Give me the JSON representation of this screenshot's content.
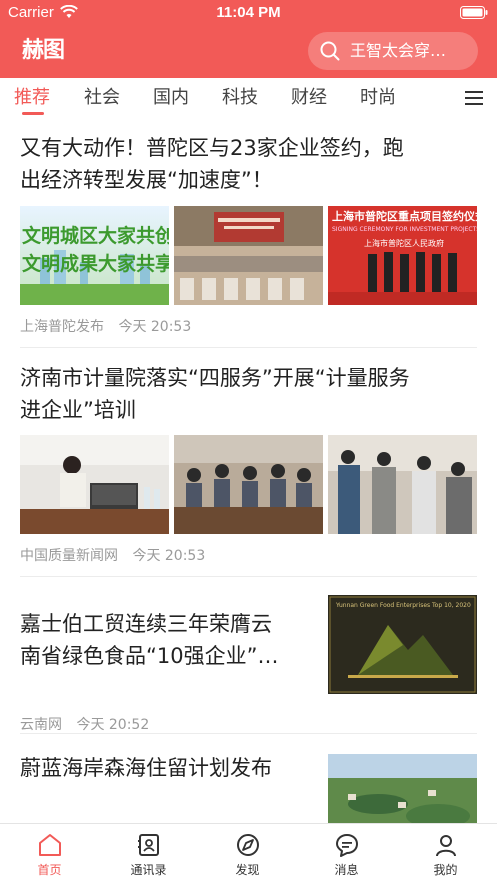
{
  "status_bar": {
    "carrier": "Carrier",
    "time": "11:04 PM"
  },
  "header": {
    "logo": "赫图",
    "search_placeholder": "王智太会穿…"
  },
  "tabs": [
    {
      "label": "推荐",
      "active": true
    },
    {
      "label": "社会",
      "active": false
    },
    {
      "label": "国内",
      "active": false
    },
    {
      "label": "科技",
      "active": false
    },
    {
      "label": "财经",
      "active": false
    },
    {
      "label": "时尚",
      "active": false
    }
  ],
  "articles": [
    {
      "title_line1": "又有大动作！普陀区与23家企业签约，跑",
      "title_line2": "出经济转型发展“加速度”！",
      "images": [
        "文明城区大家共创 文明成果大家共享",
        "上海市普陀区重点项目签约仪式",
        "上海市普陀区重点项目签约仪式 SIGNING CEREMONY FOR INVESTMENT PROJECTS 上海市普陀区人民政府"
      ],
      "source": "上海普陀发布",
      "time": "今天 20:53"
    },
    {
      "title_line1": "济南市计量院落实“四服务”开展“计量服务",
      "title_line2": "进企业”培训",
      "images": [
        "training-photo",
        "meeting-photo",
        "visit-photo"
      ],
      "source": "中国质量新闻网",
      "time": "今天 20:53"
    },
    {
      "title_line1": "嘉士伯工贸连续三年荣膺云",
      "title_line2": "南省绿色食品“10强企业”…",
      "image": "Yunnan Green Food Enterprises Top 10, 2020",
      "source": "云南网",
      "time": "今天 20:52"
    },
    {
      "title_line1": "蔚蓝海岸森海住留计划发布",
      "image": "aerial-photo"
    }
  ],
  "bottom_nav": [
    {
      "label": "首页",
      "icon": "home-icon",
      "active": true
    },
    {
      "label": "通讯录",
      "icon": "contacts-icon",
      "active": false
    },
    {
      "label": "发现",
      "icon": "discover-icon",
      "active": false
    },
    {
      "label": "消息",
      "icon": "message-icon",
      "active": false
    },
    {
      "label": "我的",
      "icon": "profile-icon",
      "active": false
    }
  ],
  "colors": {
    "accent": "#f25a57",
    "meta": "#9a9a9a"
  }
}
